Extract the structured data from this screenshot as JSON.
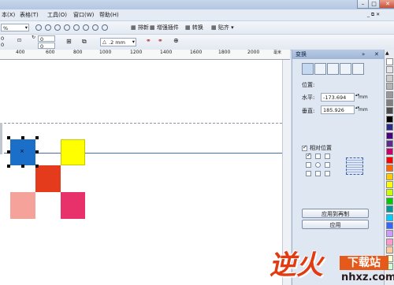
{
  "menubar": {
    "items": [
      "本(X)",
      "表格(T)",
      "工具(O)",
      "窗口(W)",
      "帮助(H)"
    ]
  },
  "toolbar": {
    "zoom": "%",
    "x_value": "0",
    "y_value": "0",
    "x2_value": "0",
    "y2_value": "0",
    "outline_width": ".2 mm",
    "btn_arrange": "排新",
    "btn_plugin": "增强插件",
    "btn_convert": "转换",
    "btn_snap": "贴齐"
  },
  "ruler": {
    "ticks": [
      "400",
      "600",
      "800",
      "1000",
      "1200",
      "1400",
      "1600",
      "1800",
      "2000"
    ],
    "unit": "毫米"
  },
  "docker": {
    "title": "变换",
    "position_label": "位置:",
    "h_label": "水平:",
    "h_value": "-173.694",
    "v_label": "垂直:",
    "v_value": "185.926",
    "unit": "mm",
    "relative_label": "相对位置",
    "apply_copy": "应用到再制",
    "apply": "应用"
  },
  "canvas": {
    "shapes": [
      {
        "name": "blue-square",
        "color": "#1b6fc9"
      },
      {
        "name": "yellow-square",
        "color": "#ffff00"
      },
      {
        "name": "red-square",
        "color": "#e43b1c"
      },
      {
        "name": "pink-square",
        "color": "#f4a29a"
      },
      {
        "name": "magenta-square",
        "color": "#e8306b"
      }
    ]
  },
  "palette": {
    "colors": [
      "#ffffff",
      "#e6e6e6",
      "#cccccc",
      "#b3b3b3",
      "#999999",
      "#808080",
      "#4d4d4d",
      "#000000",
      "#2a2a8c",
      "#4b0082",
      "#5a2d8c",
      "#c8006e",
      "#ff0000",
      "#ff6600",
      "#ffcc00",
      "#ffff00",
      "#ccff00",
      "#00cc00",
      "#009999",
      "#00ccff",
      "#3366ff",
      "#cc99ff",
      "#ff99cc",
      "#ffcc99",
      "#ffffcc",
      "#ccffcc"
    ]
  },
  "watermark": {
    "brand": "逆火",
    "site_cn": "下载站",
    "site_url": "nhxz.com"
  }
}
